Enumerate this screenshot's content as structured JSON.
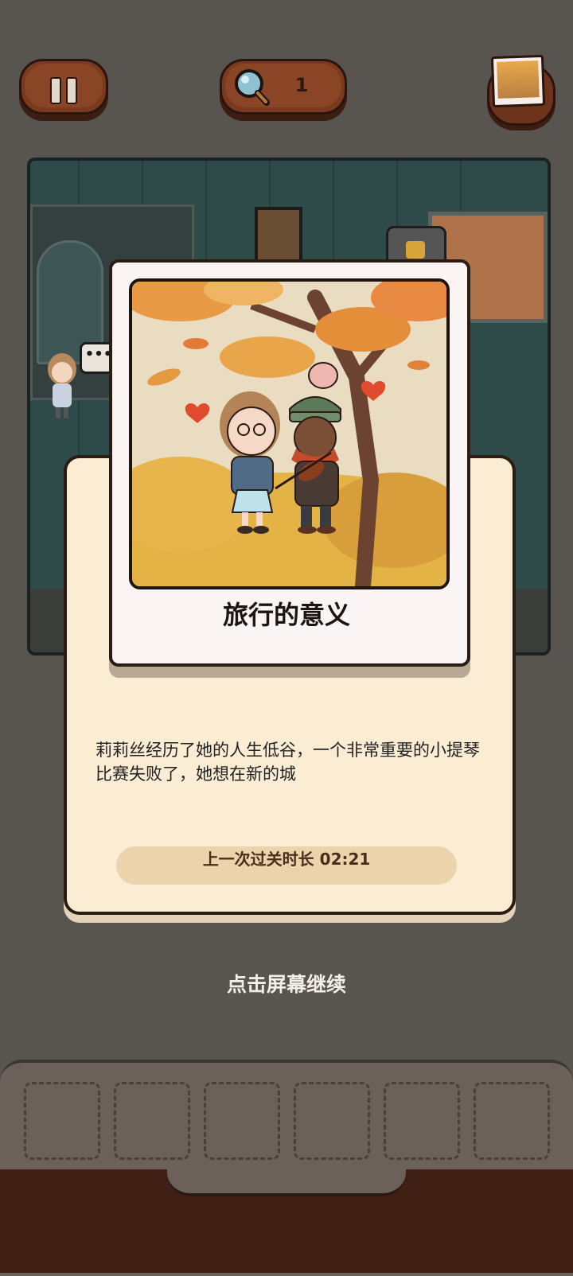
{
  "top_bar": {
    "pause_icon": "pause-icon",
    "hint_icon": "magnifier-icon",
    "hint_count": "1",
    "album_icon": "photo-album-icon"
  },
  "scene": {
    "npc_bubble": "•••"
  },
  "card": {
    "title": "旅行的意义",
    "description": "莉莉丝经历了她的人生低谷，一个非常重要的小提琴比赛失败了，她想在新的城",
    "last_time_label": "上一次过关时长 02:21"
  },
  "continue_hint": "点击屏幕继续",
  "inventory": {
    "slot_count": 6
  },
  "colors": {
    "button_brown": "#7a3a1e",
    "panel_cream": "#fbecd4",
    "overlay": "#585450",
    "tray_dark": "#3f1e14"
  }
}
